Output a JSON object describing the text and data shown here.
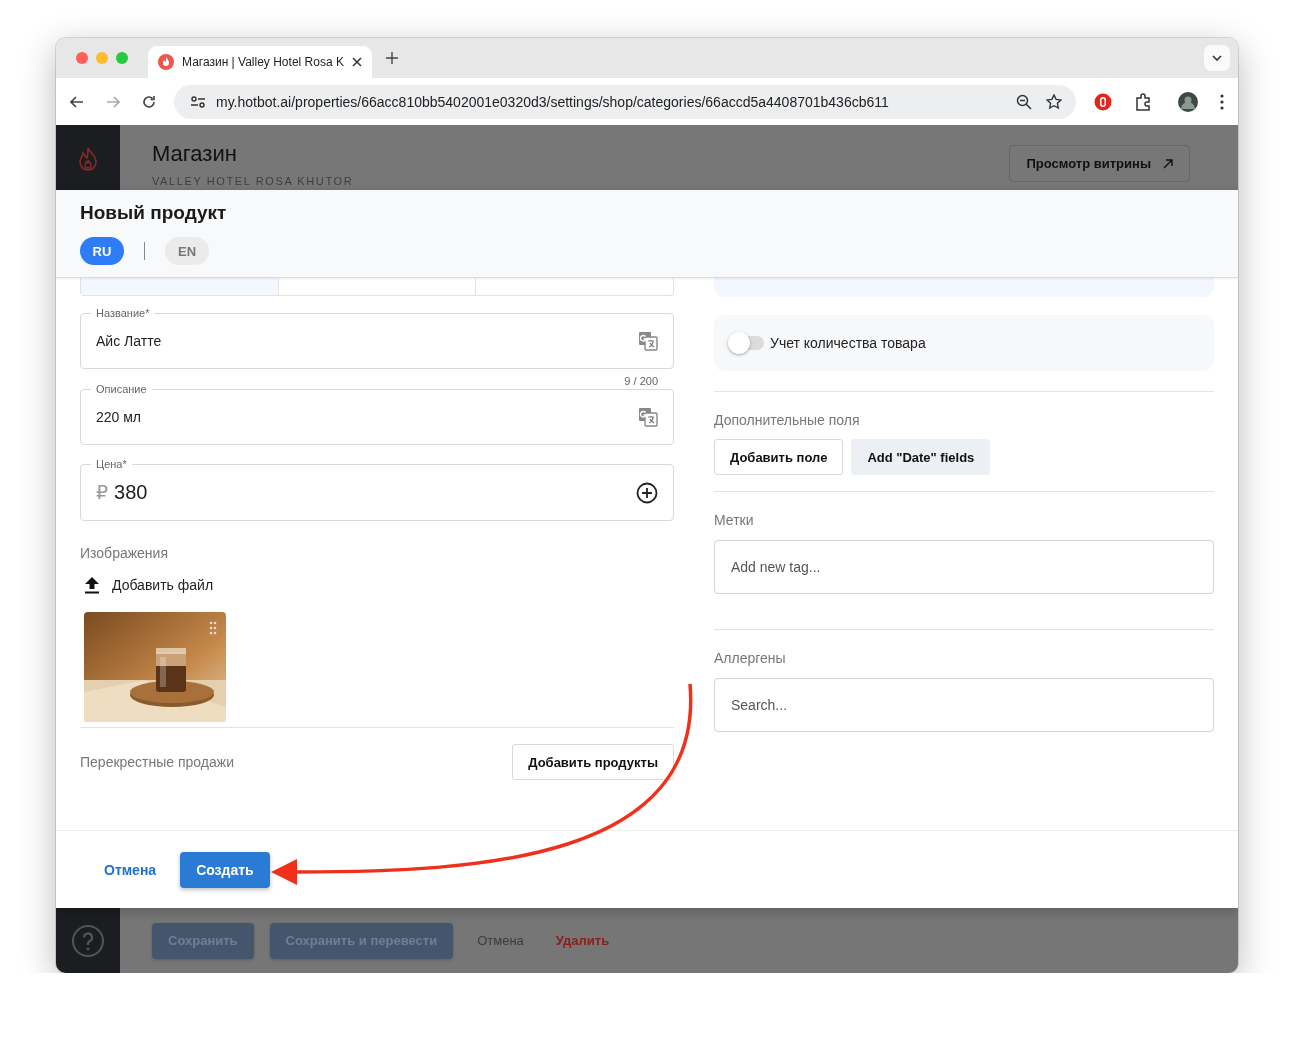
{
  "browser": {
    "tab_title": "Магазин | Valley Hotel Rosa K",
    "url": "my.hotbot.ai/properties/66acc810bb5402001e0320d3/settings/shop/categories/66accd5a4408701b436cb611"
  },
  "page": {
    "title": "Магазин",
    "subtitle": "VALLEY HOTEL ROSA KHUTOR",
    "storefront_button": "Просмотр витрины",
    "footer_buttons": [
      {
        "label": "Сохранить",
        "kind": "primary"
      },
      {
        "label": "Сохранить и перевести",
        "kind": "primary"
      },
      {
        "label": "Отмена",
        "kind": "plain"
      },
      {
        "label": "Удалить",
        "kind": "danger"
      }
    ]
  },
  "modal": {
    "title": "Новый продукт",
    "languages": [
      {
        "label": "RU",
        "selected": true
      },
      {
        "label": "EN",
        "selected": false
      }
    ],
    "name": {
      "label": "Название*",
      "value": "Айс Латте",
      "counter": "9 / 200"
    },
    "description": {
      "label": "Описание",
      "value": "220 мл"
    },
    "price": {
      "label": "Цена*",
      "currency": "₽",
      "value": "380"
    },
    "images": {
      "label": "Изображения",
      "upload": "Добавить файл"
    },
    "cross_sell": {
      "label": "Перекрестные продажи",
      "button": "Добавить продукты"
    },
    "stock_toggle": {
      "label": "Учет количества товара",
      "on": false
    },
    "extra_fields": {
      "label": "Дополнительные поля",
      "buttons": [
        {
          "label": "Добавить поле",
          "kind": "outline"
        },
        {
          "label": "Add \"Date\" fields",
          "kind": "filled"
        }
      ]
    },
    "tags": {
      "label": "Метки",
      "placeholder": "Add new tag..."
    },
    "allergens": {
      "label": "Аллергены",
      "placeholder": "Search..."
    },
    "cancel": "Отмена",
    "create": "Создать"
  }
}
